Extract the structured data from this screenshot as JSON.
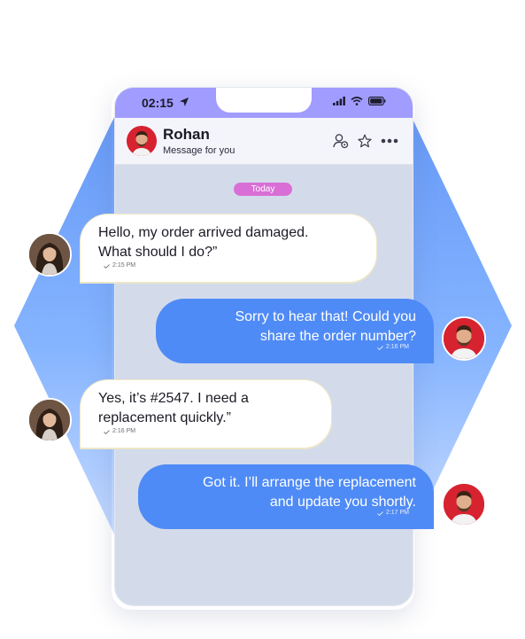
{
  "status_bar": {
    "time": "02:15"
  },
  "header": {
    "contact_name": "Rohan",
    "subtitle": "Message for you"
  },
  "date_divider": "Today",
  "messages": [
    {
      "direction": "incoming",
      "text": "Hello, my order arrived damaged.\nWhat should I do?”",
      "time": "2:15 PM"
    },
    {
      "direction": "outgoing",
      "text": "Sorry to hear that! Could you\nshare the order number?",
      "time": "2:16 PM"
    },
    {
      "direction": "incoming",
      "text": "Yes, it’s #2547. I need a\nreplacement quickly.”",
      "time": "2:16 PM"
    },
    {
      "direction": "outgoing",
      "text": "Got it. I’ll arrange the replacement\nand update you shortly.",
      "time": "2:17 PM"
    }
  ],
  "colors": {
    "status_bar": "#a19cff",
    "outgoing_bubble": "#4f8bf6",
    "incoming_bubble": "#ffffff",
    "date_pill": "#d96fd6",
    "hexagon": "#5d93f7",
    "avatar_male_bg": "#d72230"
  },
  "icons": {
    "navigation": "location-arrow-icon",
    "signal": "cellular-signal-icon",
    "wifi": "wifi-icon",
    "battery": "battery-icon",
    "add_contact": "user-settings-icon",
    "favorite": "star-icon",
    "more": "more-dots-icon",
    "read_receipt": "check-icon"
  }
}
